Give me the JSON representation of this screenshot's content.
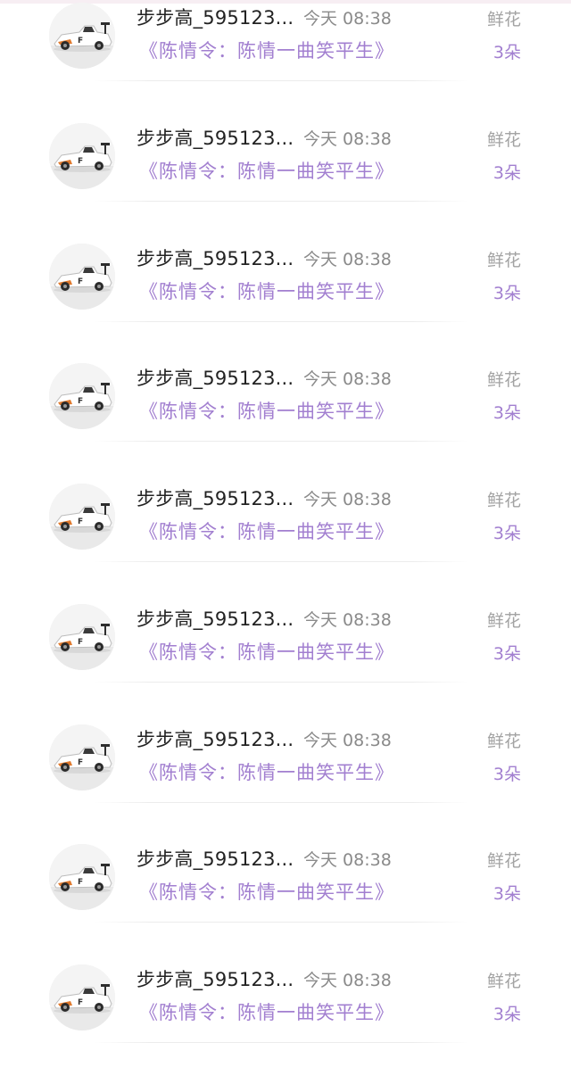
{
  "records": [
    {
      "user": "步步高_595123...",
      "time": "今天 08:38",
      "book": "《陈情令：陈情一曲笑平生》",
      "gift_type": "鲜花",
      "gift_count": "3朵",
      "avatar_icon": "race-car-avatar-icon"
    },
    {
      "user": "步步高_595123...",
      "time": "今天 08:38",
      "book": "《陈情令：陈情一曲笑平生》",
      "gift_type": "鲜花",
      "gift_count": "3朵",
      "avatar_icon": "race-car-avatar-icon"
    },
    {
      "user": "步步高_595123...",
      "time": "今天 08:38",
      "book": "《陈情令：陈情一曲笑平生》",
      "gift_type": "鲜花",
      "gift_count": "3朵",
      "avatar_icon": "race-car-avatar-icon"
    },
    {
      "user": "步步高_595123...",
      "time": "今天 08:38",
      "book": "《陈情令：陈情一曲笑平生》",
      "gift_type": "鲜花",
      "gift_count": "3朵",
      "avatar_icon": "race-car-avatar-icon"
    },
    {
      "user": "步步高_595123...",
      "time": "今天 08:38",
      "book": "《陈情令：陈情一曲笑平生》",
      "gift_type": "鲜花",
      "gift_count": "3朵",
      "avatar_icon": "race-car-avatar-icon"
    },
    {
      "user": "步步高_595123...",
      "time": "今天 08:38",
      "book": "《陈情令：陈情一曲笑平生》",
      "gift_type": "鲜花",
      "gift_count": "3朵",
      "avatar_icon": "race-car-avatar-icon"
    },
    {
      "user": "步步高_595123...",
      "time": "今天 08:38",
      "book": "《陈情令：陈情一曲笑平生》",
      "gift_type": "鲜花",
      "gift_count": "3朵",
      "avatar_icon": "race-car-avatar-icon"
    },
    {
      "user": "步步高_595123...",
      "time": "今天 08:38",
      "book": "《陈情令：陈情一曲笑平生》",
      "gift_type": "鲜花",
      "gift_count": "3朵",
      "avatar_icon": "race-car-avatar-icon"
    },
    {
      "user": "步步高_595123...",
      "time": "今天 08:38",
      "book": "《陈情令：陈情一曲笑平生》",
      "gift_type": "鲜花",
      "gift_count": "3朵",
      "avatar_icon": "race-car-avatar-icon"
    }
  ],
  "colors": {
    "username": "#222222",
    "time": "#8a8a8a",
    "accent_purple": "#a27fd0",
    "gift_type": "#a3a3a3"
  }
}
